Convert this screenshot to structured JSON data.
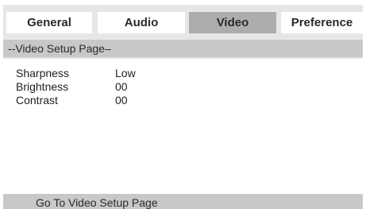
{
  "tabs": [
    {
      "label": "General",
      "active": false
    },
    {
      "label": "Audio",
      "active": false
    },
    {
      "label": "Video",
      "active": true
    },
    {
      "label": "Preference",
      "active": false
    }
  ],
  "page_title": "--Video Setup Page–",
  "settings": [
    {
      "label": "Sharpness",
      "value": "Low"
    },
    {
      "label": "Brightness",
      "value": "00"
    },
    {
      "label": "Contrast",
      "value": "00"
    }
  ],
  "status_text": "Go To Video Setup Page",
  "colors": {
    "background": "#e6e6e6",
    "active_tab": "#adadad",
    "bar": "#c8c8c8"
  }
}
